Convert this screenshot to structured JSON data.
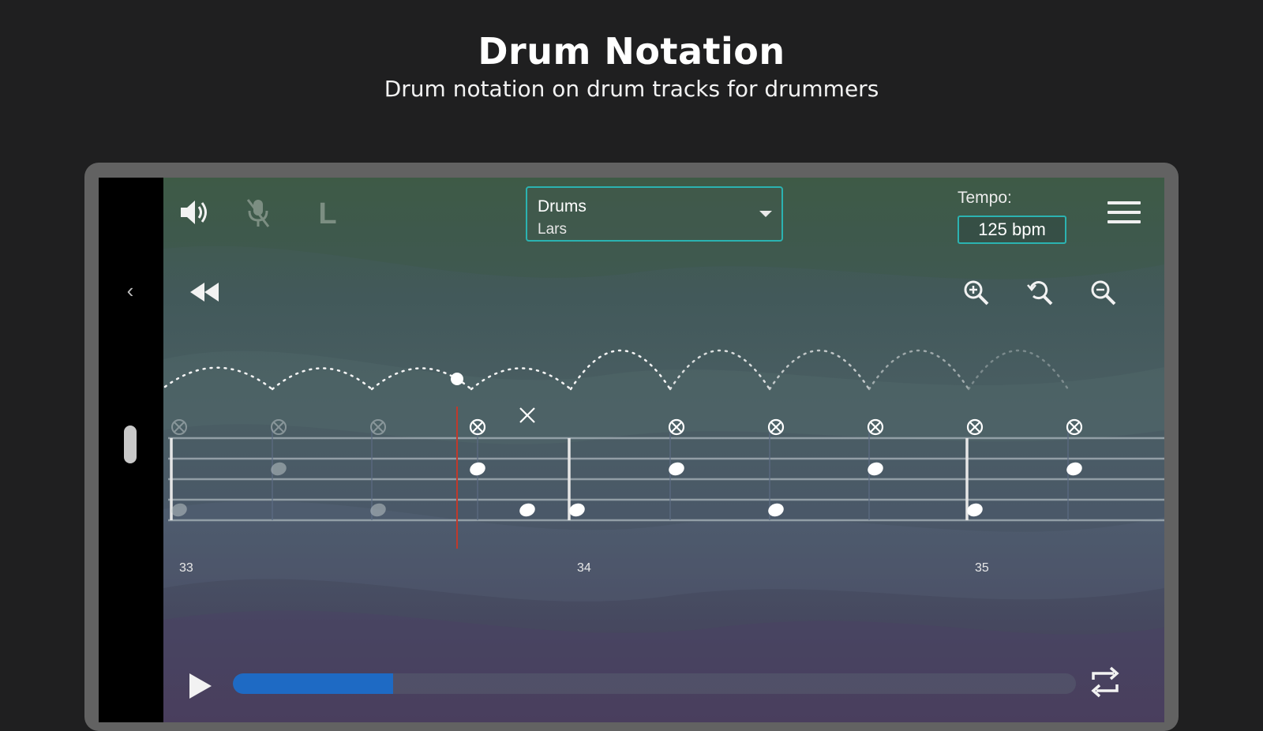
{
  "promo": {
    "title": "Drum Notation",
    "subtitle": "Drum notation on drum tracks for drummers"
  },
  "toolbar": {
    "volume_icon": "volume-icon",
    "mic_icon": "mic-off-icon",
    "l_label": "L",
    "track": {
      "name": "Drums",
      "subtitle": "Lars"
    },
    "tempo_label": "Tempo:",
    "tempo_value": "125 bpm",
    "menu_icon": "hamburger-menu-icon"
  },
  "controls": {
    "rewind_icon": "rewind-icon",
    "zoom_icons": [
      "zoom-in-icon",
      "zoom-reset-icon",
      "zoom-out-icon"
    ]
  },
  "notation": {
    "measures": [
      "33",
      "34",
      "35"
    ]
  },
  "transport": {
    "progress": 0.19,
    "play_icon": "play-icon",
    "loop_icon": "loop-icon"
  },
  "colors": {
    "accent": "#2bb3b1",
    "progress": "#1e6ac4",
    "playhead": "#c0392b"
  }
}
